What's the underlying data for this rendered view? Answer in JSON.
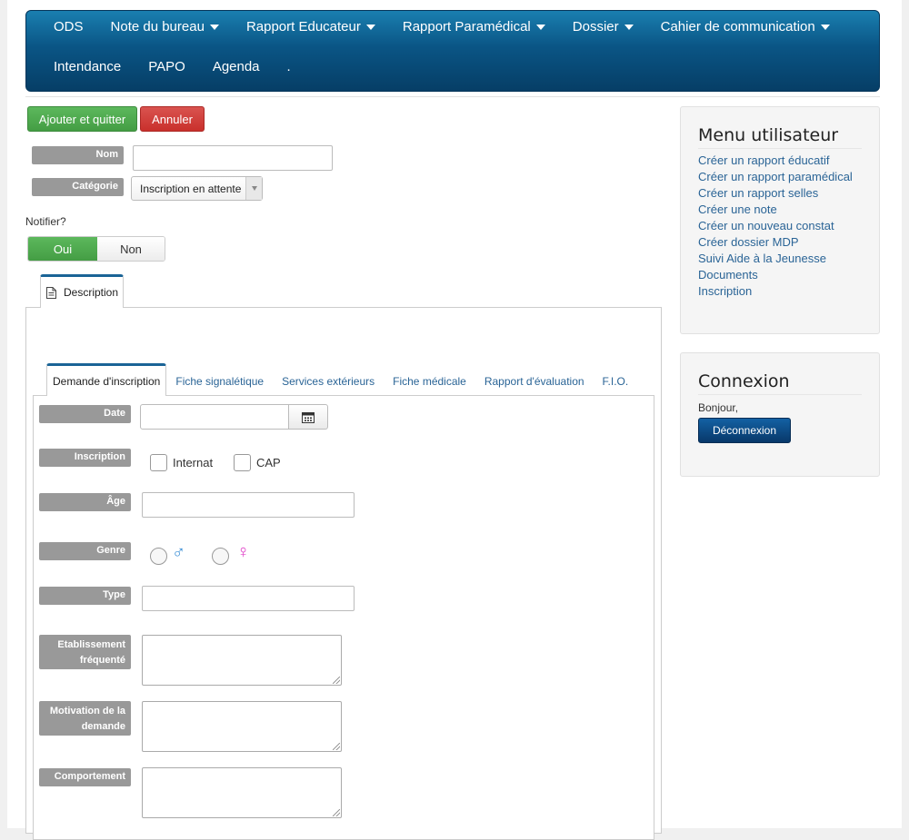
{
  "nav": {
    "row1": [
      {
        "label": "ODS",
        "dropdown": false
      },
      {
        "label": "Note du bureau",
        "dropdown": true
      },
      {
        "label": "Rapport Educateur",
        "dropdown": true
      },
      {
        "label": "Rapport Paramédical",
        "dropdown": true
      },
      {
        "label": "Dossier",
        "dropdown": true
      },
      {
        "label": "Cahier de communication",
        "dropdown": true
      }
    ],
    "row2": [
      {
        "label": "Intendance"
      },
      {
        "label": "PAPO"
      },
      {
        "label": "Agenda"
      },
      {
        "label": "."
      }
    ]
  },
  "actions": {
    "save_label": "Ajouter et quitter",
    "cancel_label": "Annuler"
  },
  "form": {
    "nom_label": "Nom",
    "nom_value": "",
    "categorie_label": "Catégorie",
    "categorie_value": "Inscription en attente",
    "notify_label": "Notifier?",
    "notify_yes": "Oui",
    "notify_no": "Non",
    "notify_selected": "Oui"
  },
  "outer_tab": {
    "label": "Description"
  },
  "inner_tabs": [
    {
      "label": "Demande d'inscription",
      "active": true
    },
    {
      "label": "Fiche signalétique",
      "active": false
    },
    {
      "label": "Services extérieurs",
      "active": false
    },
    {
      "label": "Fiche médicale",
      "active": false
    },
    {
      "label": "Rapport d'évaluation",
      "active": false
    },
    {
      "label": "F.I.O.",
      "active": false
    }
  ],
  "fields": {
    "date_label": "Date",
    "inscription_label": "Inscription",
    "internat_label": "Internat",
    "cap_label": "CAP",
    "age_label": "Âge",
    "genre_label": "Genre",
    "male_symbol": "♂",
    "female_symbol": "♀",
    "type_label": "Type",
    "etablissement_label_1": "Etablissement",
    "etablissement_label_2": "fréquenté",
    "motivation_label_1": "Motivation de la",
    "motivation_label_2": "demande",
    "comportement_label": "Comportement"
  },
  "sidebar": {
    "menu_title": "Menu utilisateur",
    "menu_items": [
      "Créer un rapport éducatif",
      "Créer un rapport paramédical",
      "Créer un rapport selles",
      "Créer une note",
      "Créer un nouveau constat",
      "Créer dossier MDP",
      "Suivi Aide à la Jeunesse",
      "Documents",
      "Inscription"
    ],
    "login_title": "Connexion",
    "greeting": "Bonjour,",
    "logout_label": "Déconnexion"
  },
  "colors": {
    "nav_bg": "#0a5585",
    "green": "#5cb85c",
    "red": "#d9534f",
    "link": "#2a6496",
    "male": "#3b8fd6",
    "female": "#e040c8",
    "label_bg": "#999999"
  }
}
